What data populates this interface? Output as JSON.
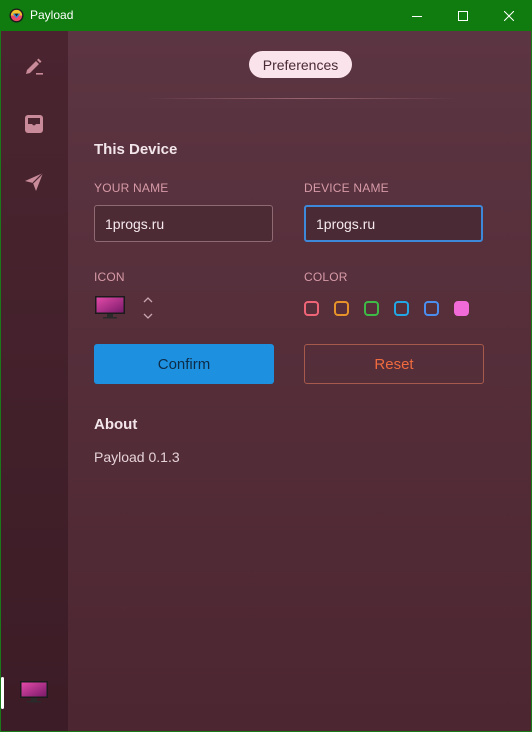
{
  "window": {
    "title": "Payload",
    "titlebar_color": "#107c10"
  },
  "sidebar": {
    "items": [
      {
        "name": "edit",
        "icon": "pencil-icon"
      },
      {
        "name": "inbox",
        "icon": "inbox-icon"
      },
      {
        "name": "send",
        "icon": "paper-plane-icon"
      }
    ],
    "device_icon": "monitor-icon"
  },
  "header": {
    "pill_label": "Preferences"
  },
  "this_device": {
    "section_title": "This Device",
    "your_name_label": "YOUR NAME",
    "your_name_value": "1progs.ru",
    "device_name_label": "DEVICE NAME",
    "device_name_value": "1progs.ru",
    "icon_label": "ICON",
    "selected_icon": "monitor-icon",
    "color_label": "COLOR",
    "colors": [
      "#f06477",
      "#e8932a",
      "#3dbb46",
      "#22a6e6",
      "#4a8ef0",
      "#f06bd8"
    ],
    "selected_color": "#f06bd8",
    "confirm_label": "Confirm",
    "reset_label": "Reset"
  },
  "about": {
    "section_title": "About",
    "version": "Payload 0.1.3"
  }
}
